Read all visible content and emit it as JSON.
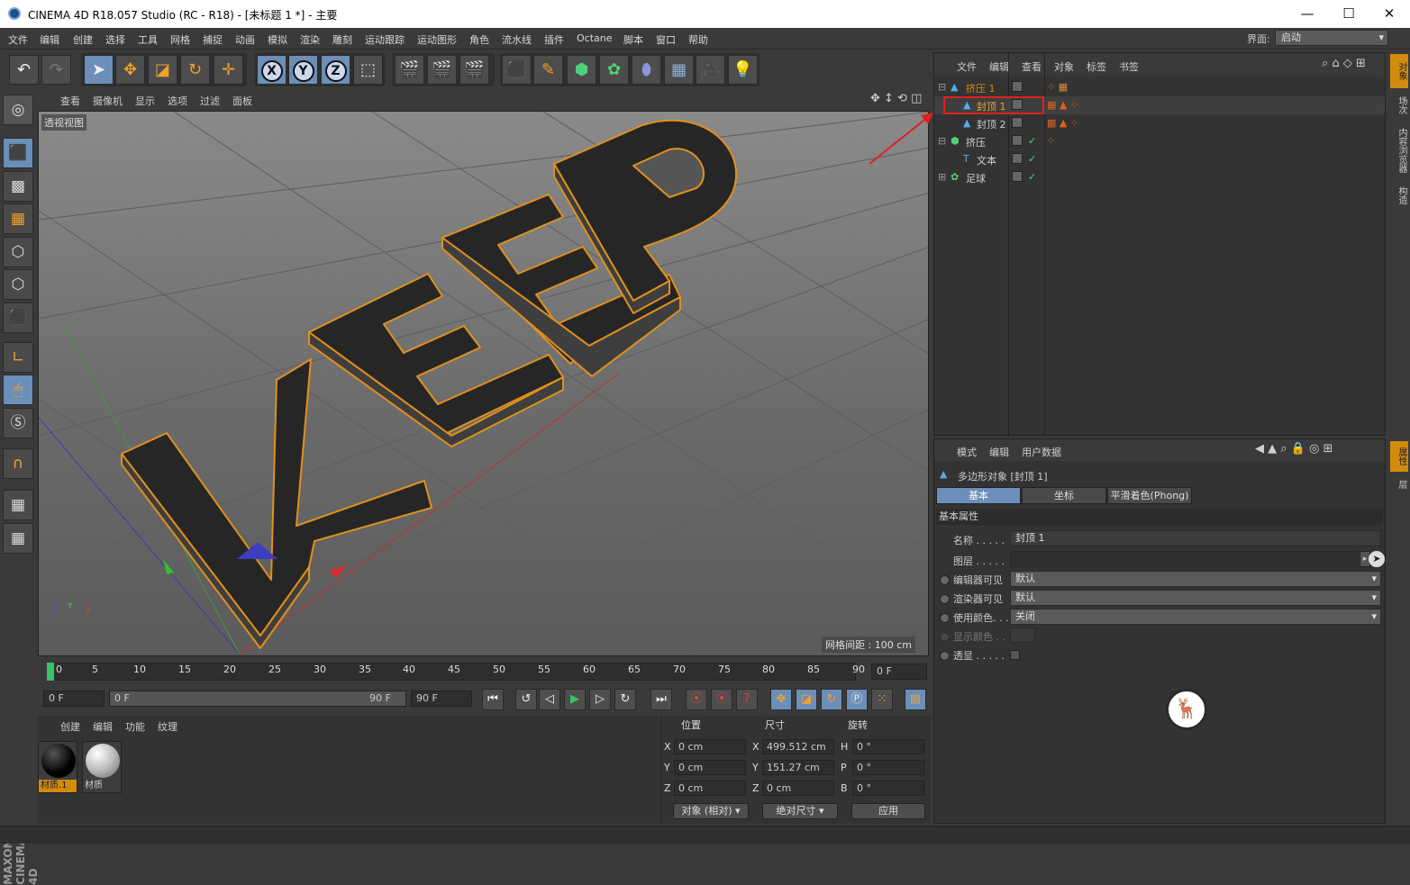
{
  "window": {
    "title": "CINEMA 4D R18.057 Studio (RC - R18) - [未标题 1 *] - 主要",
    "minimize": "—",
    "maximize": "☐",
    "close": "✕"
  },
  "menu": [
    "文件",
    "编辑",
    "创建",
    "选择",
    "工具",
    "网格",
    "捕捉",
    "动画",
    "模拟",
    "渲染",
    "雕刻",
    "运动跟踪",
    "运动图形",
    "角色",
    "流水线",
    "插件",
    "Octane",
    "脚本",
    "窗口",
    "帮助"
  ],
  "layout": {
    "label": "界面:",
    "value": "启动"
  },
  "viewport": {
    "menu": [
      "查看",
      "摄像机",
      "显示",
      "选项",
      "过滤",
      "面板"
    ],
    "label": "透视视图",
    "grid_spacing": "网格间距 : 100 cm",
    "scene_text": "KEEP"
  },
  "timeline": {
    "ticks": [
      "0",
      "5",
      "10",
      "15",
      "20",
      "25",
      "30",
      "35",
      "40",
      "45",
      "50",
      "55",
      "60",
      "65",
      "70",
      "75",
      "80",
      "85",
      "90"
    ],
    "current_frame": "0 F",
    "start": "0 F",
    "range_start": "0 F",
    "range_end": "90 F",
    "end": "90 F"
  },
  "materials": {
    "menu": [
      "创建",
      "编辑",
      "功能",
      "纹理"
    ],
    "items": [
      {
        "name": "材质.1"
      },
      {
        "name": "材质"
      }
    ]
  },
  "coordinates": {
    "headers": [
      "位置",
      "尺寸",
      "旋转"
    ],
    "rows": [
      {
        "axis": "X",
        "pos": "0 cm",
        "size_axis": "X",
        "size": "499.512 cm",
        "rot_axis": "H",
        "rot": "0 °"
      },
      {
        "axis": "Y",
        "pos": "0 cm",
        "size_axis": "Y",
        "size": "151.27 cm",
        "rot_axis": "P",
        "rot": "0 °"
      },
      {
        "axis": "Z",
        "pos": "0 cm",
        "size_axis": "Z",
        "size": "0 cm",
        "rot_axis": "B",
        "rot": "0 °"
      }
    ],
    "mode": "对象 (相对)",
    "size_mode": "绝对尺寸",
    "apply": "应用"
  },
  "objects": {
    "menu": [
      "文件",
      "编辑",
      "查看",
      "对象",
      "标签",
      "书签"
    ],
    "items": [
      {
        "name": "挤压 1"
      },
      {
        "name": "封顶 1"
      },
      {
        "name": "封顶 2"
      },
      {
        "name": "挤压"
      },
      {
        "name": "文本"
      },
      {
        "name": "足球"
      }
    ]
  },
  "attributes": {
    "menu": [
      "模式",
      "编辑",
      "用户数据"
    ],
    "object_title": "多边形对象 [封顶 1]",
    "tabs": [
      "基本",
      "坐标",
      "平滑着色(Phong)"
    ],
    "section": "基本属性",
    "props": [
      {
        "label": "名称 . . . . .",
        "value": "封顶 1"
      },
      {
        "label": "图层 . . . . .",
        "value": ""
      },
      {
        "label": "编辑器可见",
        "value": "默认"
      },
      {
        "label": "渲染器可见",
        "value": "默认"
      },
      {
        "label": "使用颜色. . .",
        "value": "关闭"
      },
      {
        "label": "显示颜色 . .",
        "value": ""
      },
      {
        "label": "透显 . . . . .",
        "value": ""
      }
    ]
  },
  "right_tabs": [
    "对象",
    "场次",
    "内容浏览器",
    "构造",
    "属性",
    "层"
  ],
  "brand": "MAXON CINEMA 4D",
  "colors": {
    "accent_orange": "#d38b0e",
    "active_blue": "#6b8fb8",
    "panel_bg": "#333333",
    "selection_red": "#e02020"
  }
}
